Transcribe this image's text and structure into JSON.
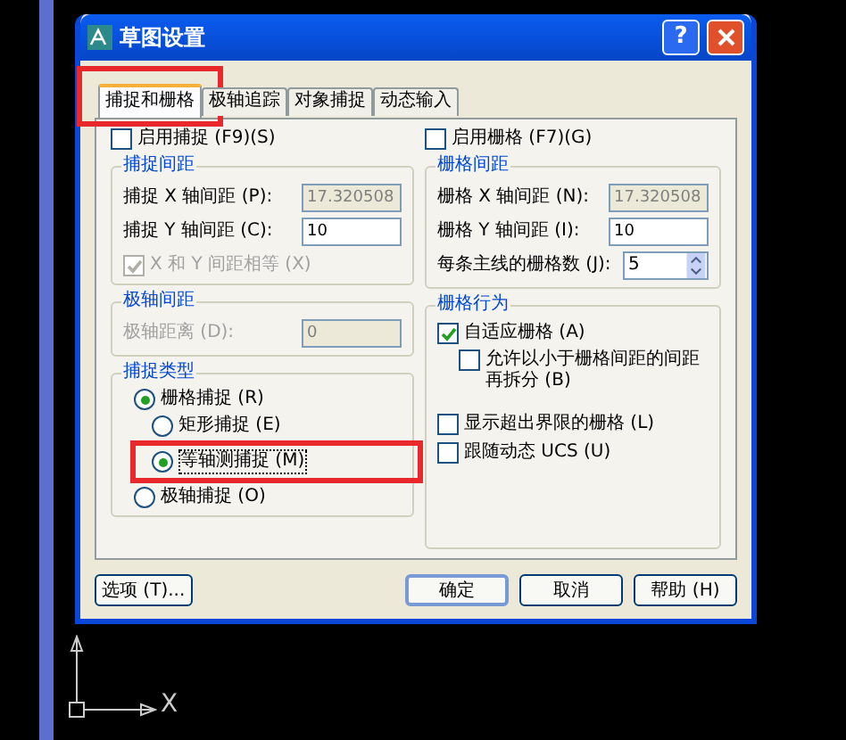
{
  "window": {
    "title": "草图设置",
    "help_button": "?"
  },
  "tabs": [
    {
      "label": "捕捉和栅格",
      "selected": true,
      "highlighted": true
    },
    {
      "label": "极轴追踪",
      "selected": false,
      "highlighted": false
    },
    {
      "label": "对象捕捉",
      "selected": false,
      "highlighted": false
    },
    {
      "label": "动态输入",
      "selected": false,
      "highlighted": false
    }
  ],
  "snap": {
    "enable": {
      "label": "启用捕捉 (F9)(S)",
      "checked": false
    },
    "spacing": {
      "title": "捕捉间距",
      "fields": [
        {
          "label": "捕捉 X 轴间距 (P):",
          "value": "17.320508",
          "disabled": true
        },
        {
          "label": "捕捉 Y 轴间距 (C):",
          "value": "10",
          "disabled": false
        }
      ],
      "equal": {
        "label": "X 和 Y 间距相等 (X)",
        "checked": true,
        "disabled": true
      }
    },
    "polar": {
      "title": "极轴间距",
      "field": {
        "label": "极轴距离 (D):",
        "value": "0",
        "disabled": true
      }
    },
    "type": {
      "title": "捕捉类型",
      "options": [
        {
          "label": "栅格捕捉 (R)",
          "selected": true,
          "children": [
            {
              "label": "矩形捕捉 (E)",
              "selected": false,
              "highlighted": false
            },
            {
              "label": "等轴测捕捉 (M)",
              "selected": true,
              "highlighted": true
            }
          ]
        },
        {
          "label": "极轴捕捉 (O)",
          "selected": false
        }
      ]
    }
  },
  "grid": {
    "enable": {
      "label": "启用栅格 (F7)(G)",
      "checked": false
    },
    "spacing": {
      "title": "栅格间距",
      "fields": [
        {
          "label": "栅格 X 轴间距 (N):",
          "value": "17.320508",
          "disabled": true
        },
        {
          "label": "栅格 Y 轴间距 (I):",
          "value": "10",
          "disabled": false
        }
      ],
      "major": {
        "label": "每条主线的栅格数 (J):",
        "value": "5"
      }
    },
    "behavior": {
      "title": "栅格行为",
      "options": [
        {
          "label": "自适应栅格 (A)",
          "checked": true,
          "children": [
            {
              "label": "允许以小于栅格间距的间距再拆分 (B)",
              "checked": false
            }
          ]
        },
        {
          "label": "显示超出界限的栅格 (L)",
          "checked": false
        },
        {
          "label": "跟随动态 UCS (U)",
          "checked": false
        }
      ]
    }
  },
  "buttons": {
    "options": "选项 (T)...",
    "ok": "确定",
    "cancel": "取消",
    "help": "帮助 (H)"
  },
  "ucs_label": "X"
}
